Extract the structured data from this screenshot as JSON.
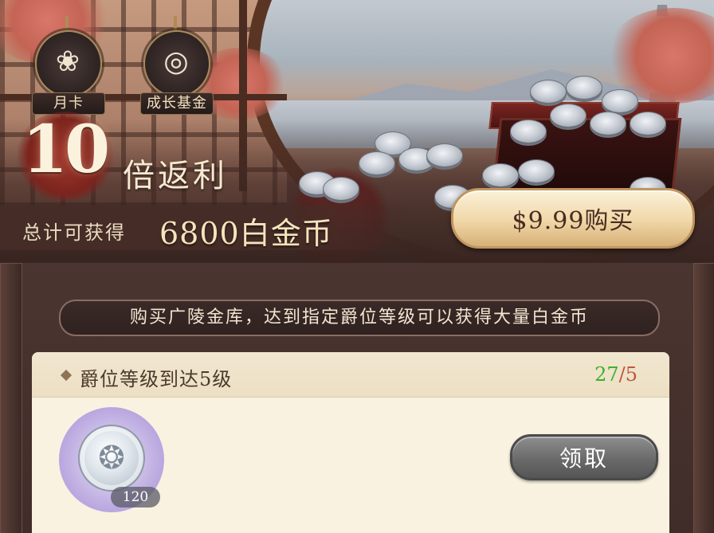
{
  "top_icons": [
    {
      "label": "月卡",
      "icon": "lotus-box-icon"
    },
    {
      "label": "成长基金",
      "icon": "coin-pouch-icon"
    }
  ],
  "banner": {
    "multiplier": "10",
    "multiplier_text": "倍返利",
    "total_label": "总计可获得",
    "total_amount": "6800白金币",
    "price_button": "$9.99购买"
  },
  "description": "购买广陵金库，达到指定爵位等级可以获得大量白金币",
  "task": {
    "title": "爵位等级到达5级",
    "progress_current": "27",
    "progress_separator": "/",
    "progress_target": "5",
    "reward_count": "120",
    "claim_button": "领取"
  },
  "colors": {
    "progress_current": "#3bb12d",
    "progress_target": "#c0563a",
    "price_button_bg": "#f0d7a7",
    "claim_button_bg": "#6a6a6a"
  }
}
